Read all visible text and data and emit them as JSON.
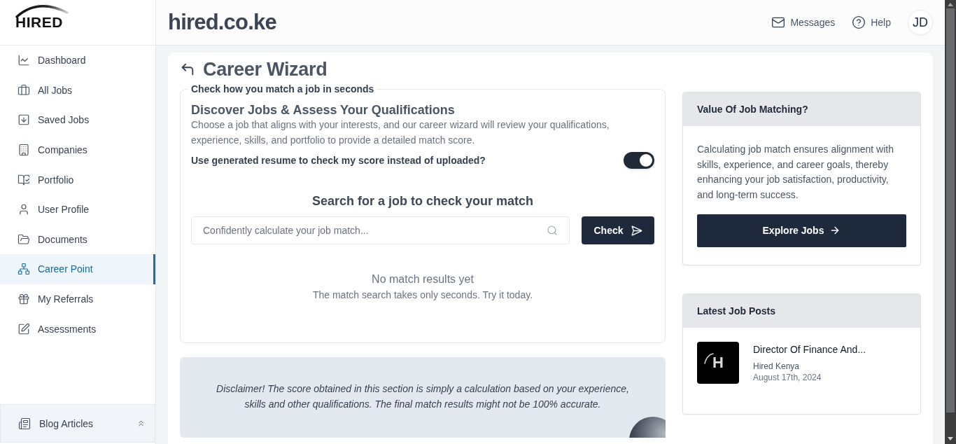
{
  "sidebar": {
    "logo_text": "HIRED",
    "items": [
      {
        "label": "Dashboard",
        "selected": false
      },
      {
        "label": "All Jobs",
        "selected": false
      },
      {
        "label": "Saved Jobs",
        "selected": false
      },
      {
        "label": "Companies",
        "selected": false
      },
      {
        "label": "Portfolio",
        "selected": false
      },
      {
        "label": "User Profile",
        "selected": false
      },
      {
        "label": "Documents",
        "selected": false
      },
      {
        "label": "Career Point",
        "selected": true
      },
      {
        "label": "My Referrals",
        "selected": false
      },
      {
        "label": "Assessments",
        "selected": false
      }
    ],
    "footer": {
      "label": "Blog Articles"
    }
  },
  "header": {
    "site_title": "hired.co.ke",
    "links": [
      {
        "label": "Messages"
      },
      {
        "label": "Help"
      }
    ],
    "avatar": {
      "initials": "JD"
    }
  },
  "page": {
    "title": "Career Wizard"
  },
  "match_panel": {
    "legend": "Check how you match a job in seconds",
    "heading": "Discover Jobs & Assess Your Qualifications",
    "description": "Choose a job that aligns with your interests, and our career wizard will review your qualifications, experience, skills, and portfolio to provide a detailed match score.",
    "toggle": {
      "label": "Use generated resume to check my score instead of uploaded?",
      "on": true
    },
    "search_heading": "Search for a job to check your match",
    "search": {
      "placeholder": "Confidently calculate your job match..."
    },
    "check_button": "Check",
    "empty_state": {
      "title": "No match results yet",
      "message": "The match search takes only seconds. Try it today."
    }
  },
  "disclaimer": "Disclaimer! The score obtained in this section is simply a calculation based on your experience, skills and other qualifications. The final match results might not be 100% accurate.",
  "value_card": {
    "title": "Value Of Job Matching?",
    "body": "Calculating job match ensures alignment with skills, experience, and career goals, thereby enhancing your job satisfaction, productivity, and long-term success.",
    "button": "Explore Jobs"
  },
  "latest_posts": {
    "title": "Latest Job Posts",
    "posts": [
      {
        "logo_text": "H",
        "title": "Director Of Finance And...",
        "company": "Hired Kenya",
        "date": "August 17th, 2024"
      }
    ]
  }
}
